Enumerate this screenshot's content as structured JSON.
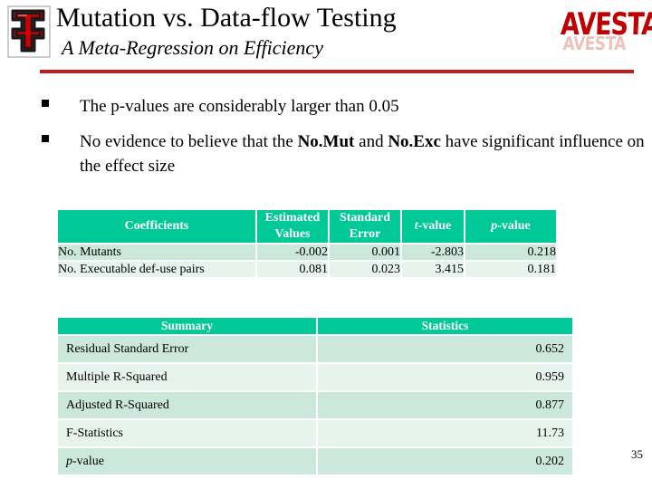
{
  "header": {
    "title": "Mutation vs. Data-flow Testing",
    "subtitle": "A Meta-Regression on Efficiency",
    "logo_left_name": "texas-tech-double-t-logo",
    "logo_right_text": "AVESTA",
    "rule_color": "#BE1E1E"
  },
  "bullets": [
    {
      "prefix": "The p-values are considerably larger than 0.05",
      "bold1": "",
      "mid": "",
      "bold2": "",
      "suffix": ""
    },
    {
      "prefix": "No evidence to believe that the ",
      "bold1": "No.Mut",
      "mid": " and ",
      "bold2": "No.Exc",
      "suffix": " have significant influence on the effect size"
    }
  ],
  "table_coefficients": {
    "headers": {
      "col0": "Coefficients",
      "col1": "Estimated Values",
      "col2": "Standard Error",
      "col3_italic": "t",
      "col3_rest": "-value",
      "col4_italic": "p",
      "col4_rest": "-value"
    },
    "rows": [
      {
        "label": "No. Mutants",
        "estimated": "-0.002",
        "std_error": "0.001",
        "t_value": "-2.803",
        "p_value": "0.218"
      },
      {
        "label": "No. Executable def-use pairs",
        "estimated": "0.081",
        "std_error": "0.023",
        "t_value": "3.415",
        "p_value": "0.181"
      }
    ]
  },
  "table_summary": {
    "headers": {
      "col0": "Summary",
      "col1": "Statistics"
    },
    "rows": [
      {
        "label": "Residual Standard Error",
        "label_italic": "",
        "label_rest": "",
        "value": "0.652"
      },
      {
        "label": "Multiple R-Squared",
        "label_italic": "",
        "label_rest": "",
        "value": "0.959"
      },
      {
        "label": "Adjusted R-Squared",
        "label_italic": "",
        "label_rest": "",
        "value": "0.877"
      },
      {
        "label": "F-Statistics",
        "label_italic": "",
        "label_rest": "",
        "value": "11.73"
      },
      {
        "label": "",
        "label_italic": "p",
        "label_rest": "-value",
        "value": "0.202"
      }
    ]
  },
  "footer": {
    "slide_number": "35"
  },
  "colors": {
    "header_teal": "#00C896",
    "row_dark": "#CCE8DC",
    "row_light": "#E7F4EE",
    "accent_red": "#BE1E1E",
    "logo_red": "#C00000"
  }
}
